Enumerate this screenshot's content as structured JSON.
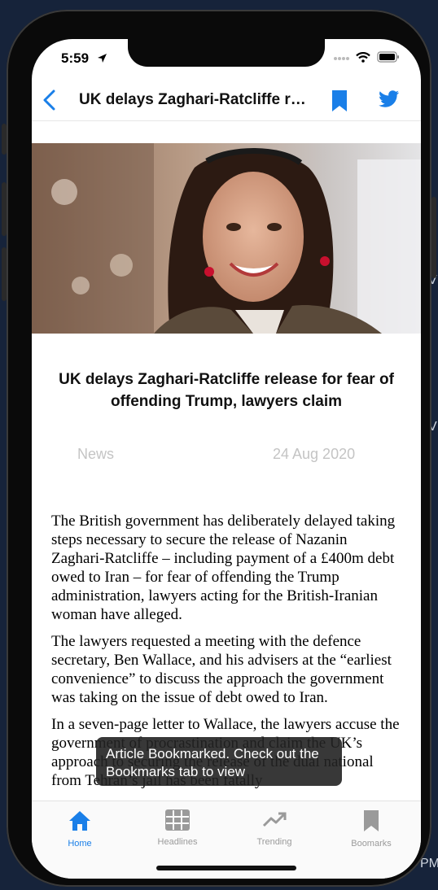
{
  "status_bar": {
    "time": "5:59"
  },
  "navbar": {
    "title": "UK delays Zaghari-Ratcliffe release for fear of offending Trump, lawyers claim"
  },
  "article": {
    "headline": "UK delays Zaghari-Ratcliffe release for fear of offending Trump, lawyers claim",
    "category": "News",
    "date": "24 Aug 2020",
    "paragraphs": [
      "The British government has deliberately delayed taking steps necessary to secure the release of Nazanin Zaghari-Ratcliffe – including payment of a £400m debt owed to Iran – for fear of offending the Trump administration, lawyers acting for the British-Iranian woman have alleged.",
      "The lawyers requested a meeting with the defence secretary, Ben Wallace, and his advisers at the “earliest convenience” to discuss the approach the government was taking on the issue of debt owed to Iran.",
      "In a seven-page letter to Wallace, the lawyers accuse the government of procrastination and claim the UK’s approach to securing the release of the dual national from Tehran’s jail has been fatally"
    ]
  },
  "toast": {
    "message": "Article Bookmarked. Check out the Bookmarks tab to view"
  },
  "tabbar": {
    "tabs": [
      {
        "label": "Home",
        "icon": "home-icon",
        "active": true
      },
      {
        "label": "Headlines",
        "icon": "grid-icon",
        "active": false
      },
      {
        "label": "Trending",
        "icon": "trending-icon",
        "active": false
      },
      {
        "label": "Boomarks",
        "icon": "bookmark-icon",
        "active": false
      }
    ]
  },
  "colors": {
    "accent": "#1a7fe8",
    "inactive": "#9a9a9a",
    "meta": "#c4c4c4"
  },
  "background_text": [
    "V",
    "V",
    "PM"
  ]
}
